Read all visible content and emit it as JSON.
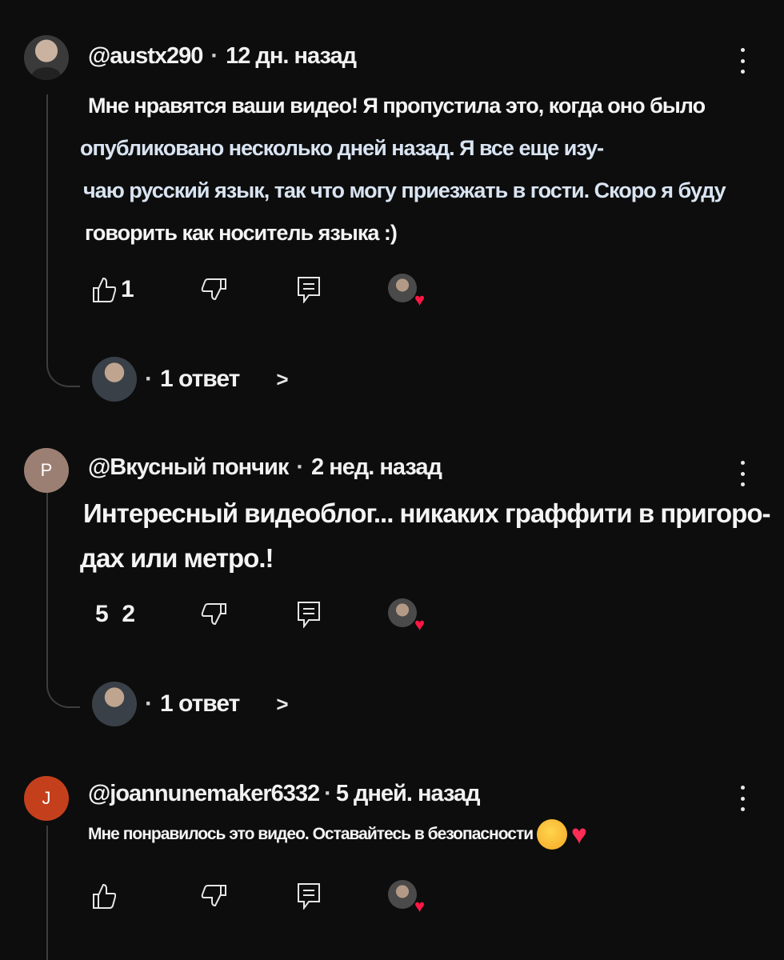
{
  "comments": [
    {
      "author": "@austx290",
      "time": "12 дн. назад",
      "text_lines": [
        "Мне нравятся ваши видео! Я пропустила это, когда оно было",
        "опубликовано несколько дней назад. Я все еще изу-",
        "чаю русский язык, так что могу приезжать в гости. Скоро я буду",
        " говорить как носитель языка :)"
      ],
      "likes": "1",
      "replies": "1 ответ",
      "avatar_type": "photo"
    },
    {
      "author": "@Вкусный пончик",
      "time": "2 нед. назад",
      "text_lines": [
        "Интересный видеоблог... никаких граффити в пригоро-",
        "дах или метро.!"
      ],
      "likes": "5  2",
      "replies": "1 ответ",
      "avatar_letter": "P",
      "avatar_color": "#9c7f73"
    },
    {
      "author": "@joannunemaker6332",
      "time": "5 дней. назад",
      "text_lines": [
        "Мне понравилось это видео. Оставайтесь в безопасности"
      ],
      "avatar_letter": "J",
      "avatar_color": "#c4401c"
    }
  ],
  "ui": {
    "separator": "·",
    "chevron": ">",
    "heart": "♥",
    "icons": [
      "like-icon",
      "dislike-icon",
      "reply-icon",
      "creator-heart-icon",
      "more-vert-icon"
    ]
  }
}
